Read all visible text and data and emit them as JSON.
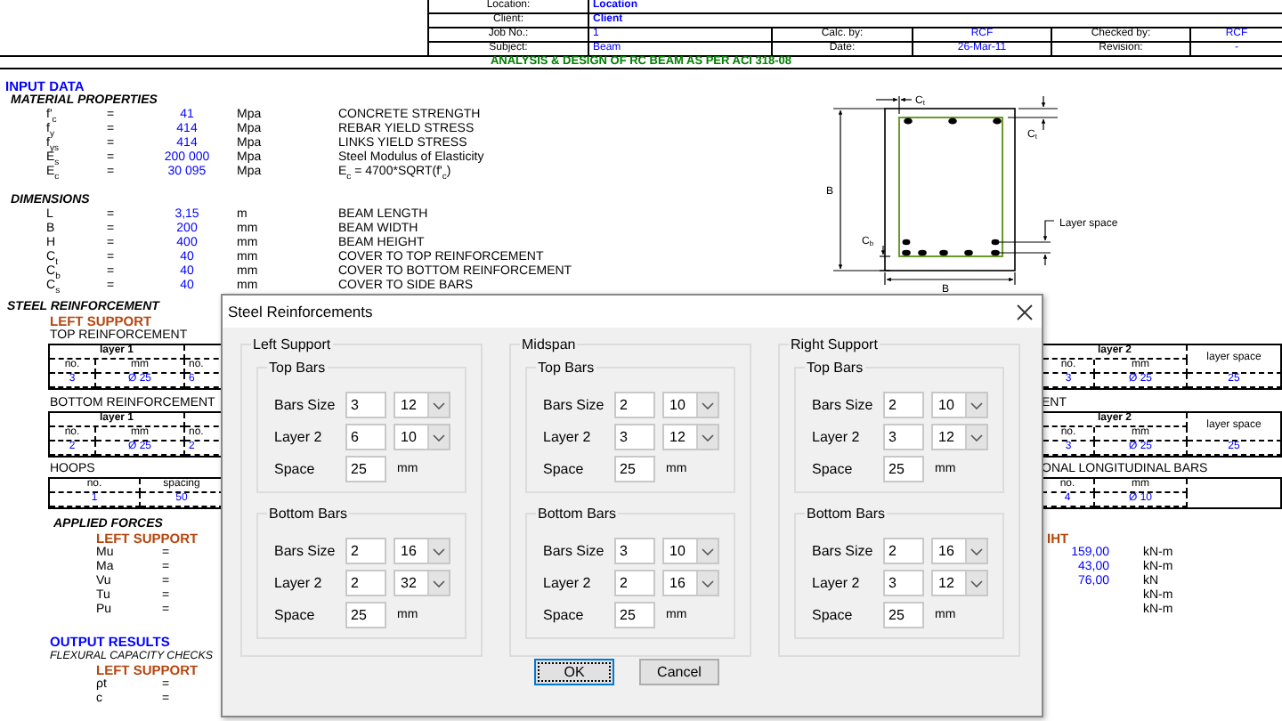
{
  "header": {
    "location_label": "Location:",
    "location": "Location",
    "client_label": "Client:",
    "client": "Client",
    "job_no_label": "Job No.:",
    "job_no": "1",
    "calc_by_label": "Calc. by:",
    "calc_by": "RCF",
    "checked_by_label": "Checked by:",
    "checked_by": "RCF",
    "subject_label": "Subject:",
    "subject": "Beam",
    "date_label": "Date:",
    "date": "26-Mar-11",
    "revision_label": "Revision:",
    "revision": "-"
  },
  "title": "ANALYSIS & DESIGN OF RC BEAM AS PER ACI 318-08",
  "input_data": {
    "heading": "INPUT DATA",
    "material": {
      "heading": "MATERIAL PROPERTIES",
      "rows": [
        {
          "symbol": "f'$_{c}$",
          "eq": "=",
          "value": "41",
          "unit": "Mpa",
          "description": "CONCRETE STRENGTH"
        },
        {
          "symbol": "f$_{y}$",
          "eq": "=",
          "value": "414",
          "unit": "Mpa",
          "description": "REBAR YIELD STRESS"
        },
        {
          "symbol": "f$_{ys}$",
          "eq": "=",
          "value": "414",
          "unit": "Mpa",
          "description": "LINKS YIELD STRESS"
        },
        {
          "symbol": "E$_{s}$",
          "eq": "=",
          "value": "200 000",
          "unit": "Mpa",
          "description": "Steel Modulus of Elasticity"
        },
        {
          "symbol": "E$_{c}$",
          "eq": "=",
          "value": "30 095",
          "unit": "Mpa",
          "description": "E$_{c}$ = 4700*SQRT(f'$_{c}$)"
        }
      ]
    },
    "dimensions": {
      "heading": "DIMENSIONS",
      "rows": [
        {
          "symbol": "L",
          "eq": "=",
          "value": "3,15",
          "unit": "m",
          "description": "BEAM LENGTH"
        },
        {
          "symbol": "B",
          "eq": "=",
          "value": "200",
          "unit": "mm",
          "description": "BEAM WIDTH"
        },
        {
          "symbol": "H",
          "eq": "=",
          "value": "400",
          "unit": "mm",
          "description": "BEAM HEIGHT"
        },
        {
          "symbol": "C$_{t}$",
          "eq": "=",
          "value": "40",
          "unit": "mm",
          "description": "COVER TO TOP REINFORCEMENT"
        },
        {
          "symbol": "C$_{b}$",
          "eq": "=",
          "value": "40",
          "unit": "mm",
          "description": "COVER TO BOTTOM REINFORCEMENT"
        },
        {
          "symbol": "C$_{s}$",
          "eq": "=",
          "value": "40",
          "unit": "mm",
          "description": "COVER TO SIDE BARS"
        }
      ]
    },
    "section_labels": {
      "top_cover": "C$_{t}$",
      "side_top_cover": "C$_{t}$",
      "bottom_cover": "C$_{b}$",
      "height": "B",
      "width": "B",
      "layer_space": "Layer space"
    }
  },
  "steel": {
    "heading": "STEEL REINFORCEMENT",
    "support": "LEFT SUPPORT",
    "top_label": "TOP REINFORCEMENT",
    "top_left": {
      "kind": "layers_left",
      "layer": "layer 1",
      "columns": [
        "no.",
        "mm",
        "no."
      ],
      "values": [
        "3",
        "Ø 25",
        "6"
      ]
    },
    "top_right": {
      "kind": "layers_right",
      "layer": "layer 2",
      "columns": [
        "no.",
        "mm"
      ],
      "space_label": "layer space",
      "values": [
        "3",
        "Ø 25",
        "25"
      ]
    },
    "bottom_label": "BOTTOM REINFORCEMENT",
    "bottom_label_right": "ENT",
    "bottom_left": {
      "kind": "layers_left",
      "layer": "layer 1",
      "columns": [
        "no.",
        "mm",
        "no."
      ],
      "values": [
        "2",
        "Ø 25",
        "2"
      ]
    },
    "bottom_right": {
      "kind": "layers_right",
      "layer": "layer 2",
      "columns": [
        "no.",
        "mm"
      ],
      "space_label": "layer space",
      "values": [
        "3",
        "Ø 25",
        "25"
      ]
    },
    "hoops_label": "HOOPS",
    "long_label": "ONAL LONGITUDINAL BARS",
    "hoops": {
      "kind": "simple",
      "columns": [
        "no.",
        "spacing"
      ],
      "values": [
        "1",
        "50"
      ]
    },
    "long_bars": {
      "kind": "simple",
      "columns": [
        "no.",
        "mm"
      ],
      "values": [
        "4",
        "Ø 10"
      ]
    }
  },
  "forces": {
    "heading": "APPLIED FORCES",
    "support": "LEFT SUPPORT",
    "support_right": "IHT",
    "rows": [
      {
        "symbol": "Mu",
        "eq": "=",
        "value": "159,00",
        "unit": "kN-m"
      },
      {
        "symbol": "Ma",
        "eq": "=",
        "value": "43,00",
        "unit": "kN-m"
      },
      {
        "symbol": "Vu",
        "eq": "=",
        "value": "76,00",
        "unit": "kN"
      },
      {
        "symbol": "Tu",
        "eq": "=",
        "unit": "kN-m"
      },
      {
        "symbol": "Pu",
        "eq": "=",
        "unit": "kN-m"
      }
    ]
  },
  "output": {
    "heading": "OUTPUT RESULTS",
    "subheading": "FLEXURAL CAPACITY CHECKS",
    "support": "LEFT SUPPORT",
    "rows": [
      {
        "symbol": "ρt",
        "eq": "="
      },
      {
        "symbol": "c",
        "eq": "="
      }
    ]
  },
  "dialog": {
    "title": "Steel Reinforcements",
    "groups": [
      {
        "title": "Left Support",
        "sections": [
          {
            "title": "Top Bars",
            "rows": [
              {
                "kind": "bars",
                "label": "Bars Size",
                "count": "3",
                "size": "12"
              },
              {
                "kind": "bars",
                "label": "Layer 2",
                "count": "6",
                "size": "10"
              },
              {
                "kind": "space",
                "label": "Space",
                "value": "25",
                "unit": "mm"
              }
            ]
          },
          {
            "title": "Bottom Bars",
            "rows": [
              {
                "kind": "bars",
                "label": "Bars Size",
                "count": "2",
                "size": "16"
              },
              {
                "kind": "bars",
                "label": "Layer 2",
                "count": "2",
                "size": "32"
              },
              {
                "kind": "space",
                "label": "Space",
                "value": "25",
                "unit": "mm"
              }
            ]
          }
        ]
      },
      {
        "title": "Midspan",
        "sections": [
          {
            "title": "Top Bars",
            "rows": [
              {
                "kind": "bars",
                "label": "Bars Size",
                "count": "2",
                "size": "10"
              },
              {
                "kind": "bars",
                "label": "Layer 2",
                "count": "3",
                "size": "12"
              },
              {
                "kind": "space",
                "label": "Space",
                "value": "25",
                "unit": "mm"
              }
            ]
          },
          {
            "title": "Bottom Bars",
            "rows": [
              {
                "kind": "bars",
                "label": "Bars Size",
                "count": "3",
                "size": "10"
              },
              {
                "kind": "bars",
                "label": "Layer 2",
                "count": "2",
                "size": "16"
              },
              {
                "kind": "space",
                "label": "Space",
                "value": "25",
                "unit": "mm"
              }
            ]
          }
        ]
      },
      {
        "title": "Right Support",
        "sections": [
          {
            "title": "Top Bars",
            "rows": [
              {
                "kind": "bars",
                "label": "Bars Size",
                "count": "2",
                "size": "10"
              },
              {
                "kind": "bars",
                "label": "Layer 2",
                "count": "3",
                "size": "12"
              },
              {
                "kind": "space",
                "label": "Space",
                "value": "25",
                "unit": "mm"
              }
            ]
          },
          {
            "title": "Bottom Bars",
            "rows": [
              {
                "kind": "bars",
                "label": "Bars Size",
                "count": "2",
                "size": "16"
              },
              {
                "kind": "bars",
                "label": "Layer 2",
                "count": "3",
                "size": "12"
              },
              {
                "kind": "space",
                "label": "Space",
                "value": "25",
                "unit": "mm"
              }
            ]
          }
        ]
      }
    ],
    "buttons": [
      {
        "label": "OK",
        "default": true
      },
      {
        "label": "Cancel",
        "default": false
      }
    ]
  }
}
